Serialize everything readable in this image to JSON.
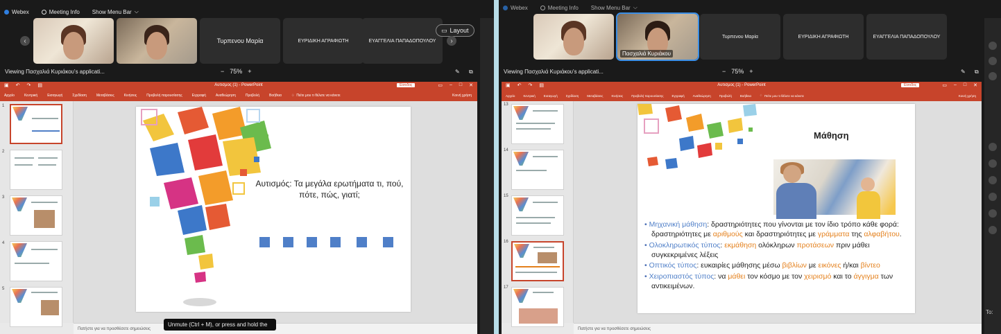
{
  "app": {
    "name": "Webex",
    "menu_info": "Meeting Info",
    "menu_show": "Show Menu Bar"
  },
  "left": {
    "tiles": [
      {
        "type": "video",
        "label": ""
      },
      {
        "type": "video",
        "label": ""
      },
      {
        "type": "name",
        "label": "Τυρπενου Μαρία"
      },
      {
        "type": "name",
        "label": "ΕΥΡΙΔΙΚΗ ΑΓΡΑΦΙΩΤΗ"
      },
      {
        "type": "name",
        "label": "ΕΥΑΓΓΕΛΙΑ ΠΑΠΑΔΟΠΟΥΛΟΥ"
      }
    ],
    "layout_label": "Layout",
    "viewing": "Viewing Πασχαλιά Κυριάκου's applicati...",
    "zoom_minus": "−",
    "zoom": "75%",
    "zoom_plus": "+",
    "ppt_title": "Αυτισμος (1) - PowerPoint",
    "signin": "Είσοδος",
    "ribbon": [
      "Αρχείο",
      "Κεντρική",
      "Εισαγωγή",
      "Σχεδίαση",
      "Μεταβάσεις",
      "Κινήσεις",
      "Προβολή παρουσίασης",
      "Εγγραφή",
      "Αναθεώρηση",
      "Προβολή",
      "Βοήθεια"
    ],
    "tell_me": "Πείτε μου τι θέλετε να κάνετε",
    "share": "Κοινή χρήση",
    "thumb_numbers": [
      "1",
      "2",
      "3",
      "4",
      "5"
    ],
    "slide_title": "Αυτισμός: Τα μεγάλα ερωτήματα τι, πού, πότε, πώς, γιατί;",
    "notes": "Πατήστε για να προσθέσετε σημειώσεις",
    "tooltip": "Unmute (Ctrl + M), or press and hold the"
  },
  "right": {
    "tiles": [
      {
        "type": "video",
        "label": ""
      },
      {
        "type": "video",
        "label": "Πασχαλιά Κυριάκου"
      },
      {
        "type": "name",
        "label": "Τυρπενου Μαρία"
      },
      {
        "type": "name",
        "label": "ΕΥΡΙΔΙΚΗ ΑΓΡΑΦΙΩΤΗ"
      },
      {
        "type": "name",
        "label": "ΕΥΑΓΓΕΛΙΑ ΠΑΠΑΔΟΠΟΥΛΟΥ"
      }
    ],
    "viewing": "Viewing Πασχαλιά Κυριάκου's applicati...",
    "zoom_minus": "−",
    "zoom": "75%",
    "zoom_plus": "+",
    "ppt_title": "Αυτισμος (1) - PowerPoint",
    "signin": "Είσοδος",
    "ribbon": [
      "Αρχείο",
      "Κεντρική",
      "Εισαγωγή",
      "Σχεδίαση",
      "Μεταβάσεις",
      "Κινήσεις",
      "Προβολή παρουσίασης",
      "Εγγραφή",
      "Αναθεώρηση",
      "Προβολή",
      "Βοήθεια"
    ],
    "tell_me": "Πείτε μου τι θέλετε να κάνετε",
    "share": "Κοινή χρήση",
    "thumb_numbers": [
      "13",
      "14",
      "15",
      "16",
      "17"
    ],
    "slide_title": "Μάθηση",
    "bullets": [
      {
        "term": "Μηχανική μάθηση",
        "rest": ": δραστηριότητες που γίνονται με τον ίδιο τρόπο κάθε φορά: δραστηριότητες με ",
        "h1": "αριθμούς",
        "mid": " και δραστηριότητες με ",
        "h2": "γράμματα",
        "tail": " της ",
        "h3": "αλφαβήτου",
        "end": "."
      },
      {
        "term": "Ολοκληρωτικός τύπος",
        "rest": ": ",
        "h1": "εκμάθηση",
        "mid": " ολόκληρων ",
        "h2": "προτάσεων",
        "tail": " πριν μάθει συγκεκριμένες λέξεις",
        "h3": "",
        "end": ""
      },
      {
        "term": "Οπτικός τύπος",
        "rest": ": ευκαιρίες μάθησης μέσω ",
        "h1": "βιβλίων",
        "mid": " με ",
        "h2": "εικόνες",
        "tail": " ή/και ",
        "h3": "βίντεο",
        "end": ""
      },
      {
        "term": "Χειροπιαστός τύπος",
        "rest": ":  να ",
        "h1": "μάθει",
        "mid": " τον κόσμο με τον ",
        "h2": "χειρισμό",
        "tail": " και το ",
        "h3": "άγγιγμα",
        "end": " των αντικειμένων."
      }
    ],
    "notes": "Πατήστε για να προσθέσετε σημειώσεις",
    "side_label": "To:"
  },
  "colors": {
    "ppt_accent": "#c7442b",
    "highlight": "#e4801c",
    "term": "#4f7fc8"
  }
}
